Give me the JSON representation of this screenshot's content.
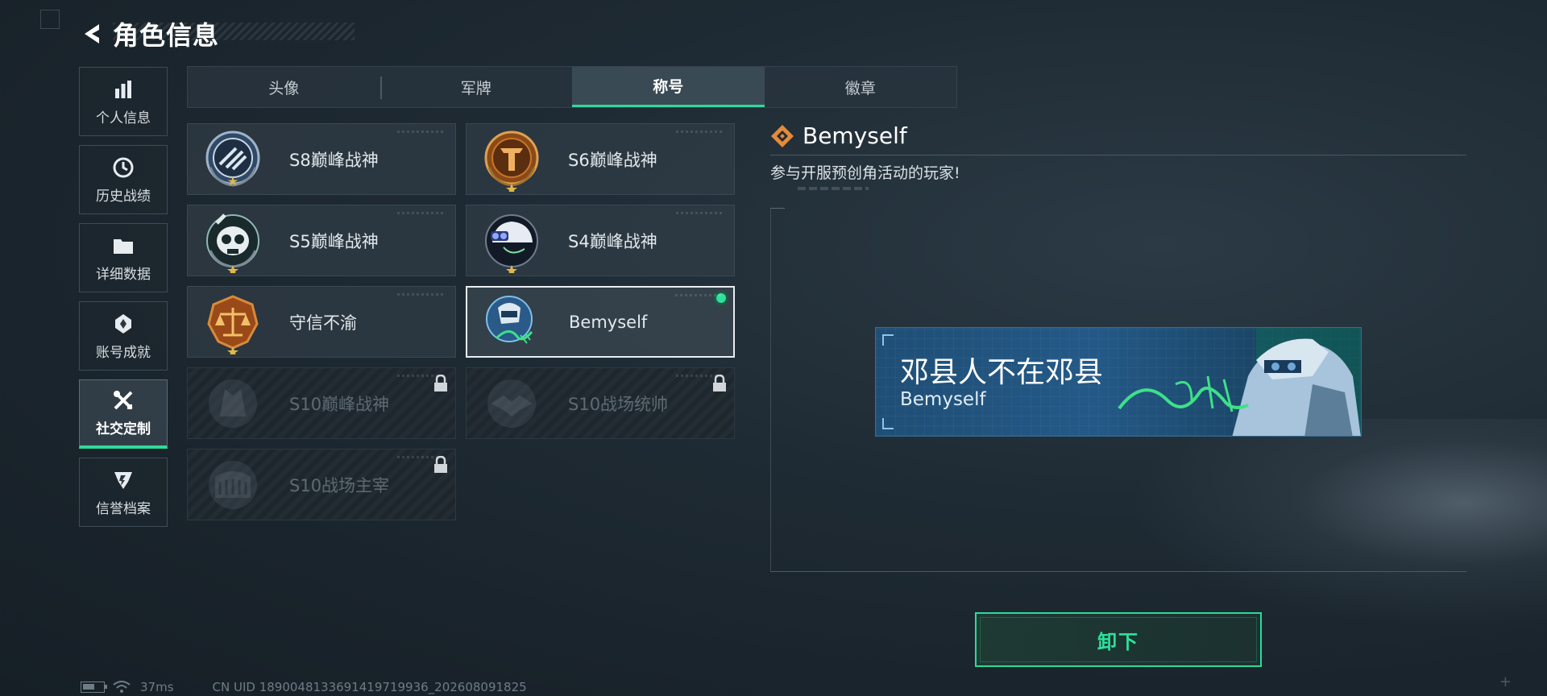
{
  "header": {
    "title": "角色信息"
  },
  "sidebar": {
    "items": [
      {
        "label": "个人信息",
        "icon": "bar-chart-icon"
      },
      {
        "label": "历史战绩",
        "icon": "history-clock-icon"
      },
      {
        "label": "详细数据",
        "icon": "folder-icon"
      },
      {
        "label": "账号成就",
        "icon": "achievement-badge-icon"
      },
      {
        "label": "社交定制",
        "icon": "tools-icon",
        "active": true
      },
      {
        "label": "信誉档案",
        "icon": "credit-shield-icon"
      }
    ]
  },
  "tabs": [
    {
      "label": "头像"
    },
    {
      "label": "军牌"
    },
    {
      "label": "称号",
      "active": true
    },
    {
      "label": "徽章"
    }
  ],
  "titles": [
    {
      "name": "S8巅峰战神",
      "emblem": "s8-emblem-icon",
      "locked": false
    },
    {
      "name": "S6巅峰战神",
      "emblem": "s6-emblem-icon",
      "locked": false
    },
    {
      "name": "S5巅峰战神",
      "emblem": "s5-skull-emblem-icon",
      "locked": false
    },
    {
      "name": "S4巅峰战神",
      "emblem": "s4-helmet-emblem-icon",
      "locked": false
    },
    {
      "name": "守信不渝",
      "emblem": "scales-emblem-icon",
      "locked": false
    },
    {
      "name": "Bemyself",
      "emblem": "bemyself-emblem-icon",
      "locked": false,
      "selected": true,
      "equipped": true
    },
    {
      "name": "S10巅峰战神",
      "emblem": "s10-emblem-icon",
      "locked": true
    },
    {
      "name": "S10战场统帅",
      "emblem": "s10-commander-emblem-icon",
      "locked": true
    },
    {
      "name": "S10战场主宰",
      "emblem": "s10-colosseum-emblem-icon",
      "locked": true
    }
  ],
  "detail": {
    "title": "Bemyself",
    "description": "参与开服预创角活动的玩家!",
    "banner_name": "邓县人不在邓县",
    "banner_sub": "Bemyself"
  },
  "actions": {
    "unequip_label": "卸下"
  },
  "status": {
    "ping": "37ms",
    "uid": "CN UID 1890048133691419719936_202608091825"
  },
  "colors": {
    "accent": "#2fd99a",
    "banner": "#245987",
    "emblem_gold": "#c8762a"
  }
}
